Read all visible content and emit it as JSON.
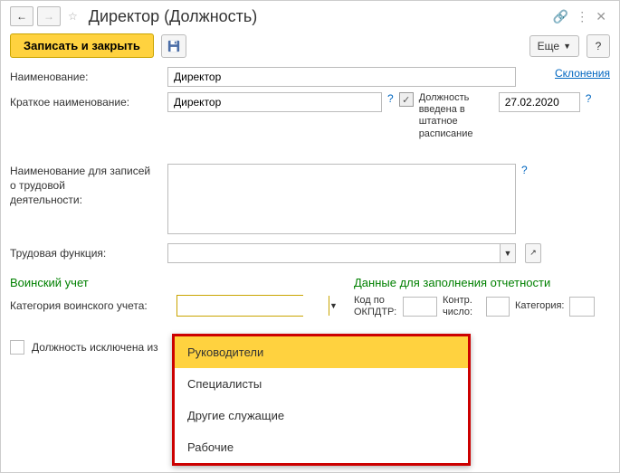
{
  "header": {
    "title": "Директор (Должность)"
  },
  "toolbar": {
    "write_close": "Записать и закрыть",
    "more": "Еще",
    "help": "?"
  },
  "labels": {
    "name": "Наименование:",
    "short_name": "Краткое наименование:",
    "declensions": "Склонения",
    "pos_in_staff": "Должность введена в штатное расписание",
    "labor_name": "Наименование для записей\nо трудовой\nдеятельности:",
    "labor_function": "Трудовая функция:",
    "military_section": "Воинский учет",
    "military_category": "Категория воинского учета:",
    "report_section": "Данные для заполнения отчетности",
    "okpdtr": "Код по ОКПДТР:",
    "control_num": "Контр. число:",
    "category": "Категория:",
    "excluded": "Должность исключена из"
  },
  "values": {
    "name": "Директор",
    "short_name": "Директор",
    "date": "27.02.2020",
    "labor_name": "",
    "labor_function": "",
    "military_category": "",
    "okpdtr": "",
    "control_num": "",
    "category": ""
  },
  "dropdown": {
    "options": [
      "Руководители",
      "Специалисты",
      "Другие служащие",
      "Рабочие"
    ],
    "highlighted": 0
  }
}
